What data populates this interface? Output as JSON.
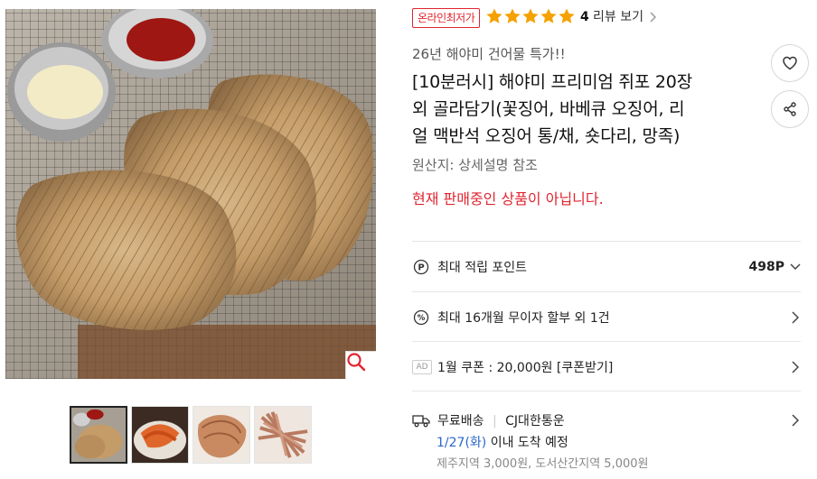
{
  "product": {
    "badge": "온라인최저가",
    "rating": 5,
    "review_count": "4",
    "review_link_label": "리뷰 보기",
    "subtitle": "26년 해야미 건어물 특가!!",
    "title_lines": [
      "[10분러시] 해야미 프리미엄 쥐포 20장",
      "외 골라담기(꽃징어, 바베큐 오징어, 리",
      "얼 맥반석 오징어 통/채, 숏다리, 망족)"
    ],
    "origin": "원산지:  상세설명 참조",
    "sale_status": "현재 판매중인 상품이 아닙니다."
  },
  "benefits": {
    "points_label": "최대 적립 포인트",
    "points_value": "498P",
    "installment_label": "최대 16개월 무이자 할부 외 1건",
    "ad_tag": "AD",
    "coupon_label": "1월 쿠폰 : 20,000원 [쿠폰받기]"
  },
  "delivery": {
    "type": "무료배송",
    "carrier": "CJ대한통운",
    "date": "1/27(화)",
    "date_suffix": " 이내 도착 예정",
    "fee_note": "제주지역 3,000원, 도서산간지역 5,000원"
  },
  "icons": {
    "zoom": "search-icon",
    "like": "heart-icon",
    "share": "share-icon",
    "points": "point-icon",
    "installment": "percent-icon",
    "delivery": "truck-icon"
  },
  "colors": {
    "accent_red": "#e0252f",
    "star_orange": "#f5a100",
    "date_blue": "#2a67c9"
  }
}
